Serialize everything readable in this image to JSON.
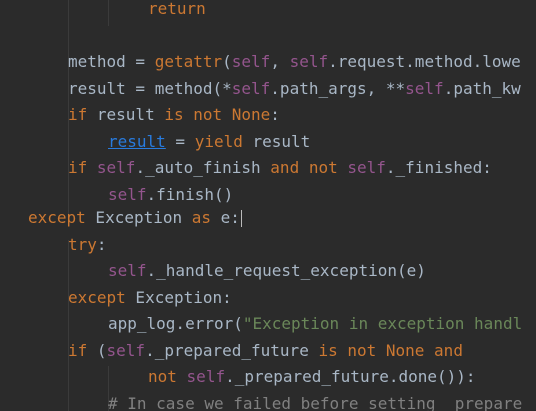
{
  "editor": {
    "lines": [
      {
        "tokens": [
          {
            "k": "kw",
            "t": "return"
          }
        ]
      },
      {
        "tokens": []
      },
      {
        "tokens": [
          {
            "k": "id",
            "t": "method = "
          },
          {
            "k": "kw",
            "t": "getattr"
          },
          {
            "k": "id",
            "t": "("
          },
          {
            "k": "self",
            "t": "self"
          },
          {
            "k": "id",
            "t": ", "
          },
          {
            "k": "self",
            "t": "self"
          },
          {
            "k": "id",
            "t": ".request.method.lowe"
          }
        ]
      },
      {
        "tokens": [
          {
            "k": "id",
            "t": "result = method(*"
          },
          {
            "k": "self",
            "t": "self"
          },
          {
            "k": "id",
            "t": ".path_args, **"
          },
          {
            "k": "self",
            "t": "self"
          },
          {
            "k": "id",
            "t": ".path_kw"
          }
        ]
      },
      {
        "tokens": [
          {
            "k": "kw",
            "t": "if"
          },
          {
            "k": "id",
            "t": " result "
          },
          {
            "k": "kw",
            "t": "is not None"
          },
          {
            "k": "id",
            "t": ":"
          }
        ]
      },
      {
        "tokens": [
          {
            "k": "ulink",
            "t": "result"
          },
          {
            "k": "id",
            "t": " = "
          },
          {
            "k": "kw",
            "t": "yield"
          },
          {
            "k": "id",
            "t": " result"
          }
        ]
      },
      {
        "tokens": [
          {
            "k": "kw",
            "t": "if"
          },
          {
            "k": "id",
            "t": " "
          },
          {
            "k": "self",
            "t": "self"
          },
          {
            "k": "id",
            "t": "._auto_finish "
          },
          {
            "k": "kw",
            "t": "and not"
          },
          {
            "k": "id",
            "t": " "
          },
          {
            "k": "self",
            "t": "self"
          },
          {
            "k": "id",
            "t": "._finished:"
          }
        ]
      },
      {
        "tokens": [
          {
            "k": "self",
            "t": "self"
          },
          {
            "k": "id",
            "t": ".finish()"
          }
        ]
      },
      {
        "tokens": [
          {
            "k": "kw",
            "t": "except"
          },
          {
            "k": "id",
            "t": " Exception "
          },
          {
            "k": "kw",
            "t": "as"
          },
          {
            "k": "id",
            "t": " e:"
          }
        ],
        "cursor": true
      },
      {
        "tokens": [
          {
            "k": "kw",
            "t": "try"
          },
          {
            "k": "id",
            "t": ":"
          }
        ]
      },
      {
        "tokens": [
          {
            "k": "self",
            "t": "self"
          },
          {
            "k": "id",
            "t": "._handle_request_exception(e)"
          }
        ]
      },
      {
        "tokens": [
          {
            "k": "kw",
            "t": "except"
          },
          {
            "k": "id",
            "t": " Exception:"
          }
        ]
      },
      {
        "tokens": [
          {
            "k": "id",
            "t": "app_log.error("
          },
          {
            "k": "str",
            "t": "\"Exception in exception handl"
          }
        ]
      },
      {
        "tokens": [
          {
            "k": "kw",
            "t": "if"
          },
          {
            "k": "id",
            "t": " ("
          },
          {
            "k": "self",
            "t": "self"
          },
          {
            "k": "id",
            "t": "._prepared_future "
          },
          {
            "k": "kw",
            "t": "is not None and"
          }
        ]
      },
      {
        "tokens": [
          {
            "k": "kw",
            "t": "not"
          },
          {
            "k": "id",
            "t": " "
          },
          {
            "k": "self",
            "t": "self"
          },
          {
            "k": "id",
            "t": "._prepared_future.done()):"
          }
        ]
      },
      {
        "tokens": [
          {
            "k": "cmt",
            "t": "# In case we failed before setting _prepare"
          }
        ]
      }
    ]
  },
  "colors": {
    "background": "#2b2b2b",
    "keyword": "#cc7832",
    "self": "#94558d",
    "string": "#6a8759",
    "comment": "#808080",
    "identifier": "#a9b7c6",
    "link": "#287bde"
  }
}
